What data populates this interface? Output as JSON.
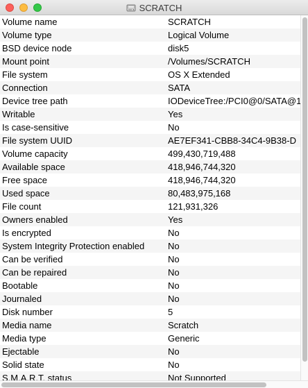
{
  "window": {
    "title": "SCRATCH",
    "title_icon": "disk-icon"
  },
  "rows": [
    {
      "key": "Volume name",
      "value": "SCRATCH"
    },
    {
      "key": "Volume type",
      "value": "Logical Volume"
    },
    {
      "key": "BSD device node",
      "value": "disk5"
    },
    {
      "key": "Mount point",
      "value": "/Volumes/SCRATCH"
    },
    {
      "key": "File system",
      "value": "OS X Extended"
    },
    {
      "key": "Connection",
      "value": "SATA"
    },
    {
      "key": "Device tree path",
      "value": "IODeviceTree:/PCI0@0/SATA@1"
    },
    {
      "key": "Writable",
      "value": "Yes"
    },
    {
      "key": "Is case-sensitive",
      "value": "No"
    },
    {
      "key": "File system UUID",
      "value": "AE7EF341-CBB8-34C4-9B38-D"
    },
    {
      "key": "Volume capacity",
      "value": "499,430,719,488"
    },
    {
      "key": "Available space",
      "value": "418,946,744,320"
    },
    {
      "key": "Free space",
      "value": "418,946,744,320"
    },
    {
      "key": "Used space",
      "value": "80,483,975,168"
    },
    {
      "key": "File count",
      "value": "121,931,326"
    },
    {
      "key": "Owners enabled",
      "value": "Yes"
    },
    {
      "key": "Is encrypted",
      "value": "No"
    },
    {
      "key": "System Integrity Protection enabled",
      "value": "No"
    },
    {
      "key": "Can be verified",
      "value": "No"
    },
    {
      "key": "Can be repaired",
      "value": "No"
    },
    {
      "key": "Bootable",
      "value": "No"
    },
    {
      "key": "Journaled",
      "value": "No"
    },
    {
      "key": "Disk number",
      "value": "5"
    },
    {
      "key": "Media name",
      "value": "Scratch"
    },
    {
      "key": "Media type",
      "value": "Generic"
    },
    {
      "key": "Ejectable",
      "value": "No"
    },
    {
      "key": "Solid state",
      "value": "No"
    },
    {
      "key": "S.M.A.R.T. status",
      "value": "Not Supported"
    }
  ]
}
